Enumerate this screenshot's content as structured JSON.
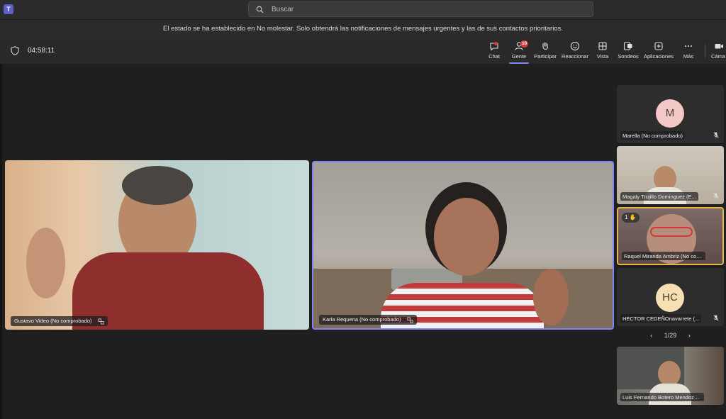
{
  "search": {
    "placeholder": "Buscar"
  },
  "notice": {
    "text": "El estado se ha establecido en No molestar. Solo obtendrá las notificaciones de mensajes urgentes y las de sus contactos prioritarios."
  },
  "meeting": {
    "timer": "04:58:11",
    "toolbar": [
      {
        "id": "chat",
        "label": "Chat",
        "icon": "chat-icon",
        "notification_dot": true
      },
      {
        "id": "gente",
        "label": "Gente",
        "icon": "people-icon",
        "badge": "10",
        "active": true
      },
      {
        "id": "participar",
        "label": "Participar",
        "icon": "raise-hand-icon"
      },
      {
        "id": "reaccionar",
        "label": "Reaccionar",
        "icon": "emoji-icon"
      },
      {
        "id": "vista",
        "label": "Vista",
        "icon": "grid-view-icon"
      },
      {
        "id": "sondeos",
        "label": "Sondeos",
        "icon": "polls-icon"
      },
      {
        "id": "aplicaciones",
        "label": "Aplicaciones",
        "icon": "plus-icon"
      },
      {
        "id": "mas",
        "label": "Más",
        "icon": "more-icon"
      },
      {
        "id": "camara",
        "label": "Cáma",
        "icon": "camera-icon"
      }
    ]
  },
  "stage": {
    "main_videos": [
      {
        "name": "Gustavo Video (No comprobado)",
        "pinned": false
      },
      {
        "name": "Karla Requena (No comprobado)",
        "speaking": true
      }
    ]
  },
  "rail": {
    "participants": [
      {
        "name": "Marella (No comprobado)",
        "initials": "M",
        "avatar_color": "#f2c9c7",
        "muted": true
      },
      {
        "name": "Magaly Trujillo Dominguez (E...",
        "video": true,
        "muted": true
      },
      {
        "name": "Raquel Miranda Ambriz (No comp...",
        "video": true,
        "hand_raised": true,
        "hand_count": "1"
      },
      {
        "name": "HECTOR CEDEÑOnavarrete (...",
        "initials": "HC",
        "avatar_color": "#f6e0b3",
        "muted": true
      },
      {
        "name": "Luis Fernando Botero Mendoza ...",
        "video": true
      }
    ],
    "pager": {
      "text": "1/29"
    }
  },
  "colors": {
    "accent": "#7f85f5",
    "hand": "#e5b64a",
    "badge": "#d83b3b"
  }
}
